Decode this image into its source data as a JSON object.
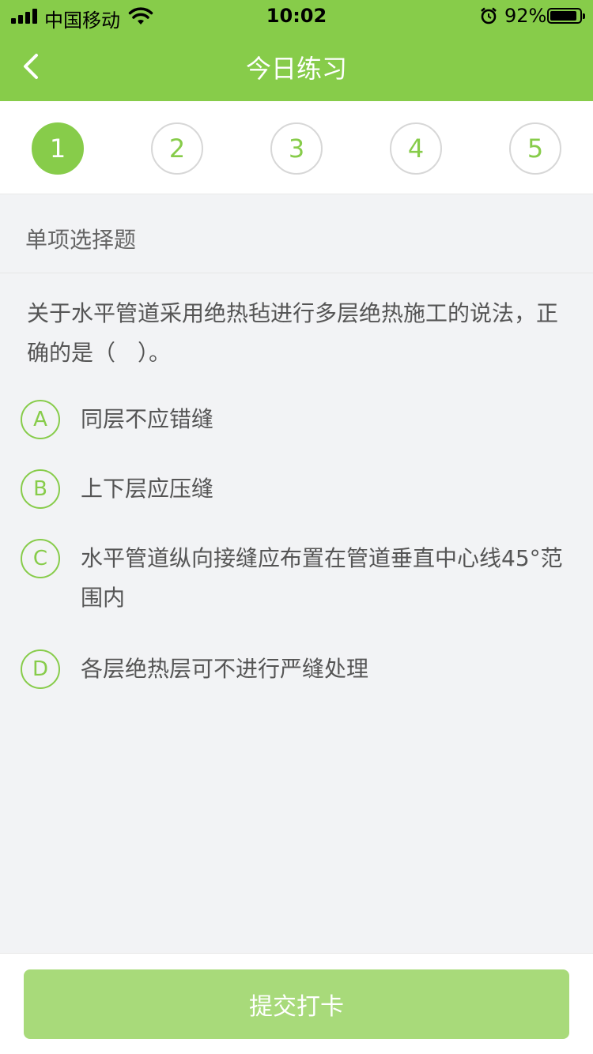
{
  "status_bar": {
    "carrier": "中国移动",
    "time": "10:02",
    "battery_pct": "92%",
    "battery_level": 0.92,
    "icons": [
      "signal-icon",
      "wifi-icon",
      "alarm-icon",
      "battery-icon"
    ]
  },
  "header": {
    "title": "今日练习",
    "back_icon": "chevron-left-icon"
  },
  "steps": {
    "items": [
      "1",
      "2",
      "3",
      "4",
      "5"
    ],
    "active": "1"
  },
  "question": {
    "type": "单项选择题",
    "text": "关于水平管道采用绝热毡进行多层绝热施工的说法，正确的是（　）。",
    "options": [
      {
        "letter": "A",
        "text": "同层不应错缝"
      },
      {
        "letter": "B",
        "text": "上下层应压缝"
      },
      {
        "letter": "C",
        "text": "水平管道纵向接缝应布置在管道垂直中心线45°范围内"
      },
      {
        "letter": "D",
        "text": "各层绝热层可不进行严缝处理"
      }
    ]
  },
  "footer": {
    "submit_label": "提交打卡"
  },
  "colors": {
    "accent": "#87cc4a",
    "button_disabled": "#a8da7a",
    "background": "#f2f3f5"
  }
}
